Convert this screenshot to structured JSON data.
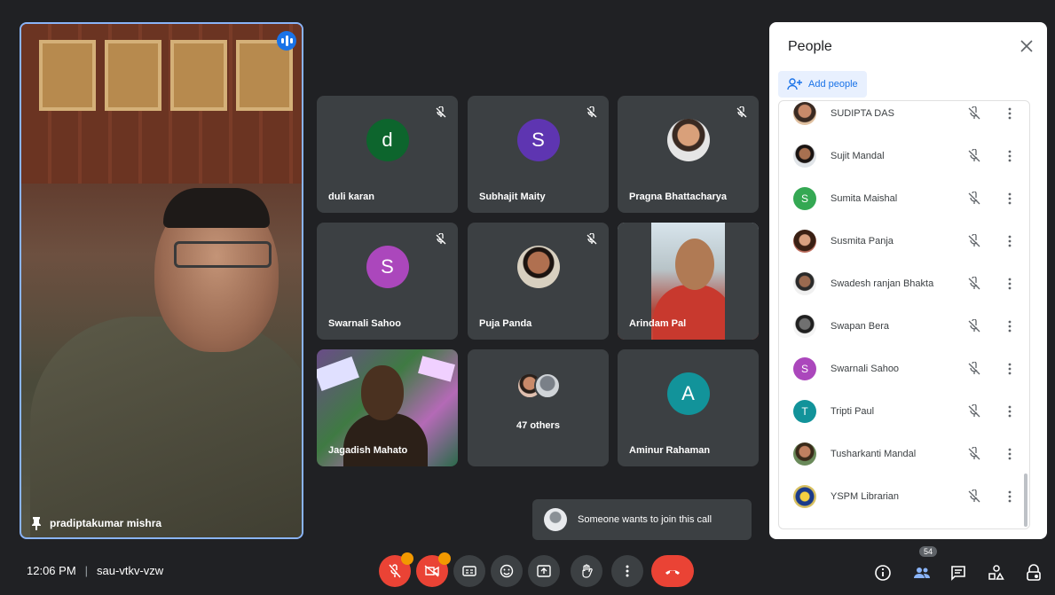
{
  "speaker": {
    "name": "pradiptakumar mishra"
  },
  "tiles": [
    {
      "name": "duli karan",
      "initial": "d",
      "color": "#0d652d"
    },
    {
      "name": "Subhajit Maity",
      "initial": "S",
      "color": "#5e35b1"
    },
    {
      "name": "Pragna Bhattacharya"
    },
    {
      "name": "Swarnali Sahoo",
      "initial": "S",
      "color": "#ab47bc"
    },
    {
      "name": "Puja Panda"
    },
    {
      "name": "Arindam Pal"
    },
    {
      "name": "Jagadish Mahato"
    },
    {
      "name": "47 others"
    },
    {
      "name": "Aminur Rahaman",
      "initial": "A",
      "color": "#12939a"
    }
  ],
  "panel": {
    "title": "People",
    "add_label": "Add people",
    "people": [
      {
        "name": "SUDIPTA DAS"
      },
      {
        "name": "Sujit Mandal"
      },
      {
        "name": "Sumita Maishal",
        "initial": "S",
        "color": "#34a853"
      },
      {
        "name": "Susmita Panja"
      },
      {
        "name": "Swadesh ranjan Bhakta"
      },
      {
        "name": "Swapan Bera"
      },
      {
        "name": "Swarnali Sahoo",
        "initial": "S",
        "color": "#ab47bc"
      },
      {
        "name": "Tripti Paul",
        "initial": "T",
        "color": "#12939a"
      },
      {
        "name": "Tusharkanti Mandal"
      },
      {
        "name": "YSPM Librarian"
      }
    ]
  },
  "toast": {
    "text": "Someone wants to join this call"
  },
  "bottom": {
    "time": "12:06 PM",
    "separator": "|",
    "code": "sau-vtkv-vzw",
    "people_count": "54"
  }
}
